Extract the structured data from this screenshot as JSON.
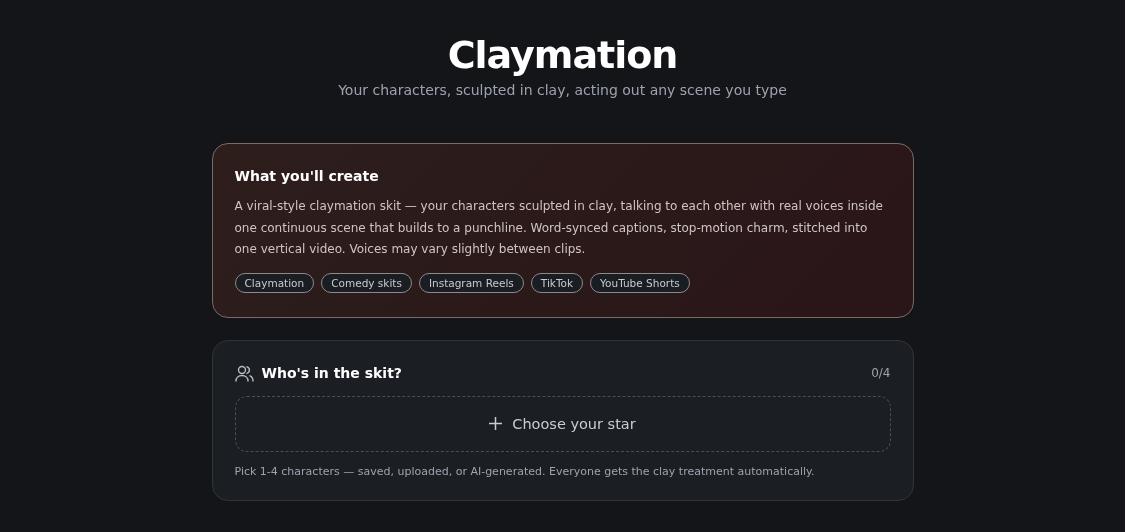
{
  "header": {
    "title": "Claymation",
    "subtitle": "Your characters, sculpted in clay, acting out any scene you type"
  },
  "overview": {
    "title": "What you'll create",
    "description": "A viral-style claymation skit — your characters sculpted in clay, talking to each other with real voices inside one continuous scene that builds to a punchline. Word-synced captions, stop-motion charm, stitched into one vertical video. Voices may vary slightly between clips.",
    "tags": [
      "Claymation",
      "Comedy skits",
      "Instagram Reels",
      "TikTok",
      "YouTube Shorts"
    ]
  },
  "cast": {
    "title": "Who's in the skit?",
    "count": "0/4",
    "add_button": "Choose your star",
    "hint": "Pick 1-4 characters — saved, uploaded, or AI-generated. Everyone gets the clay treatment automatically."
  }
}
